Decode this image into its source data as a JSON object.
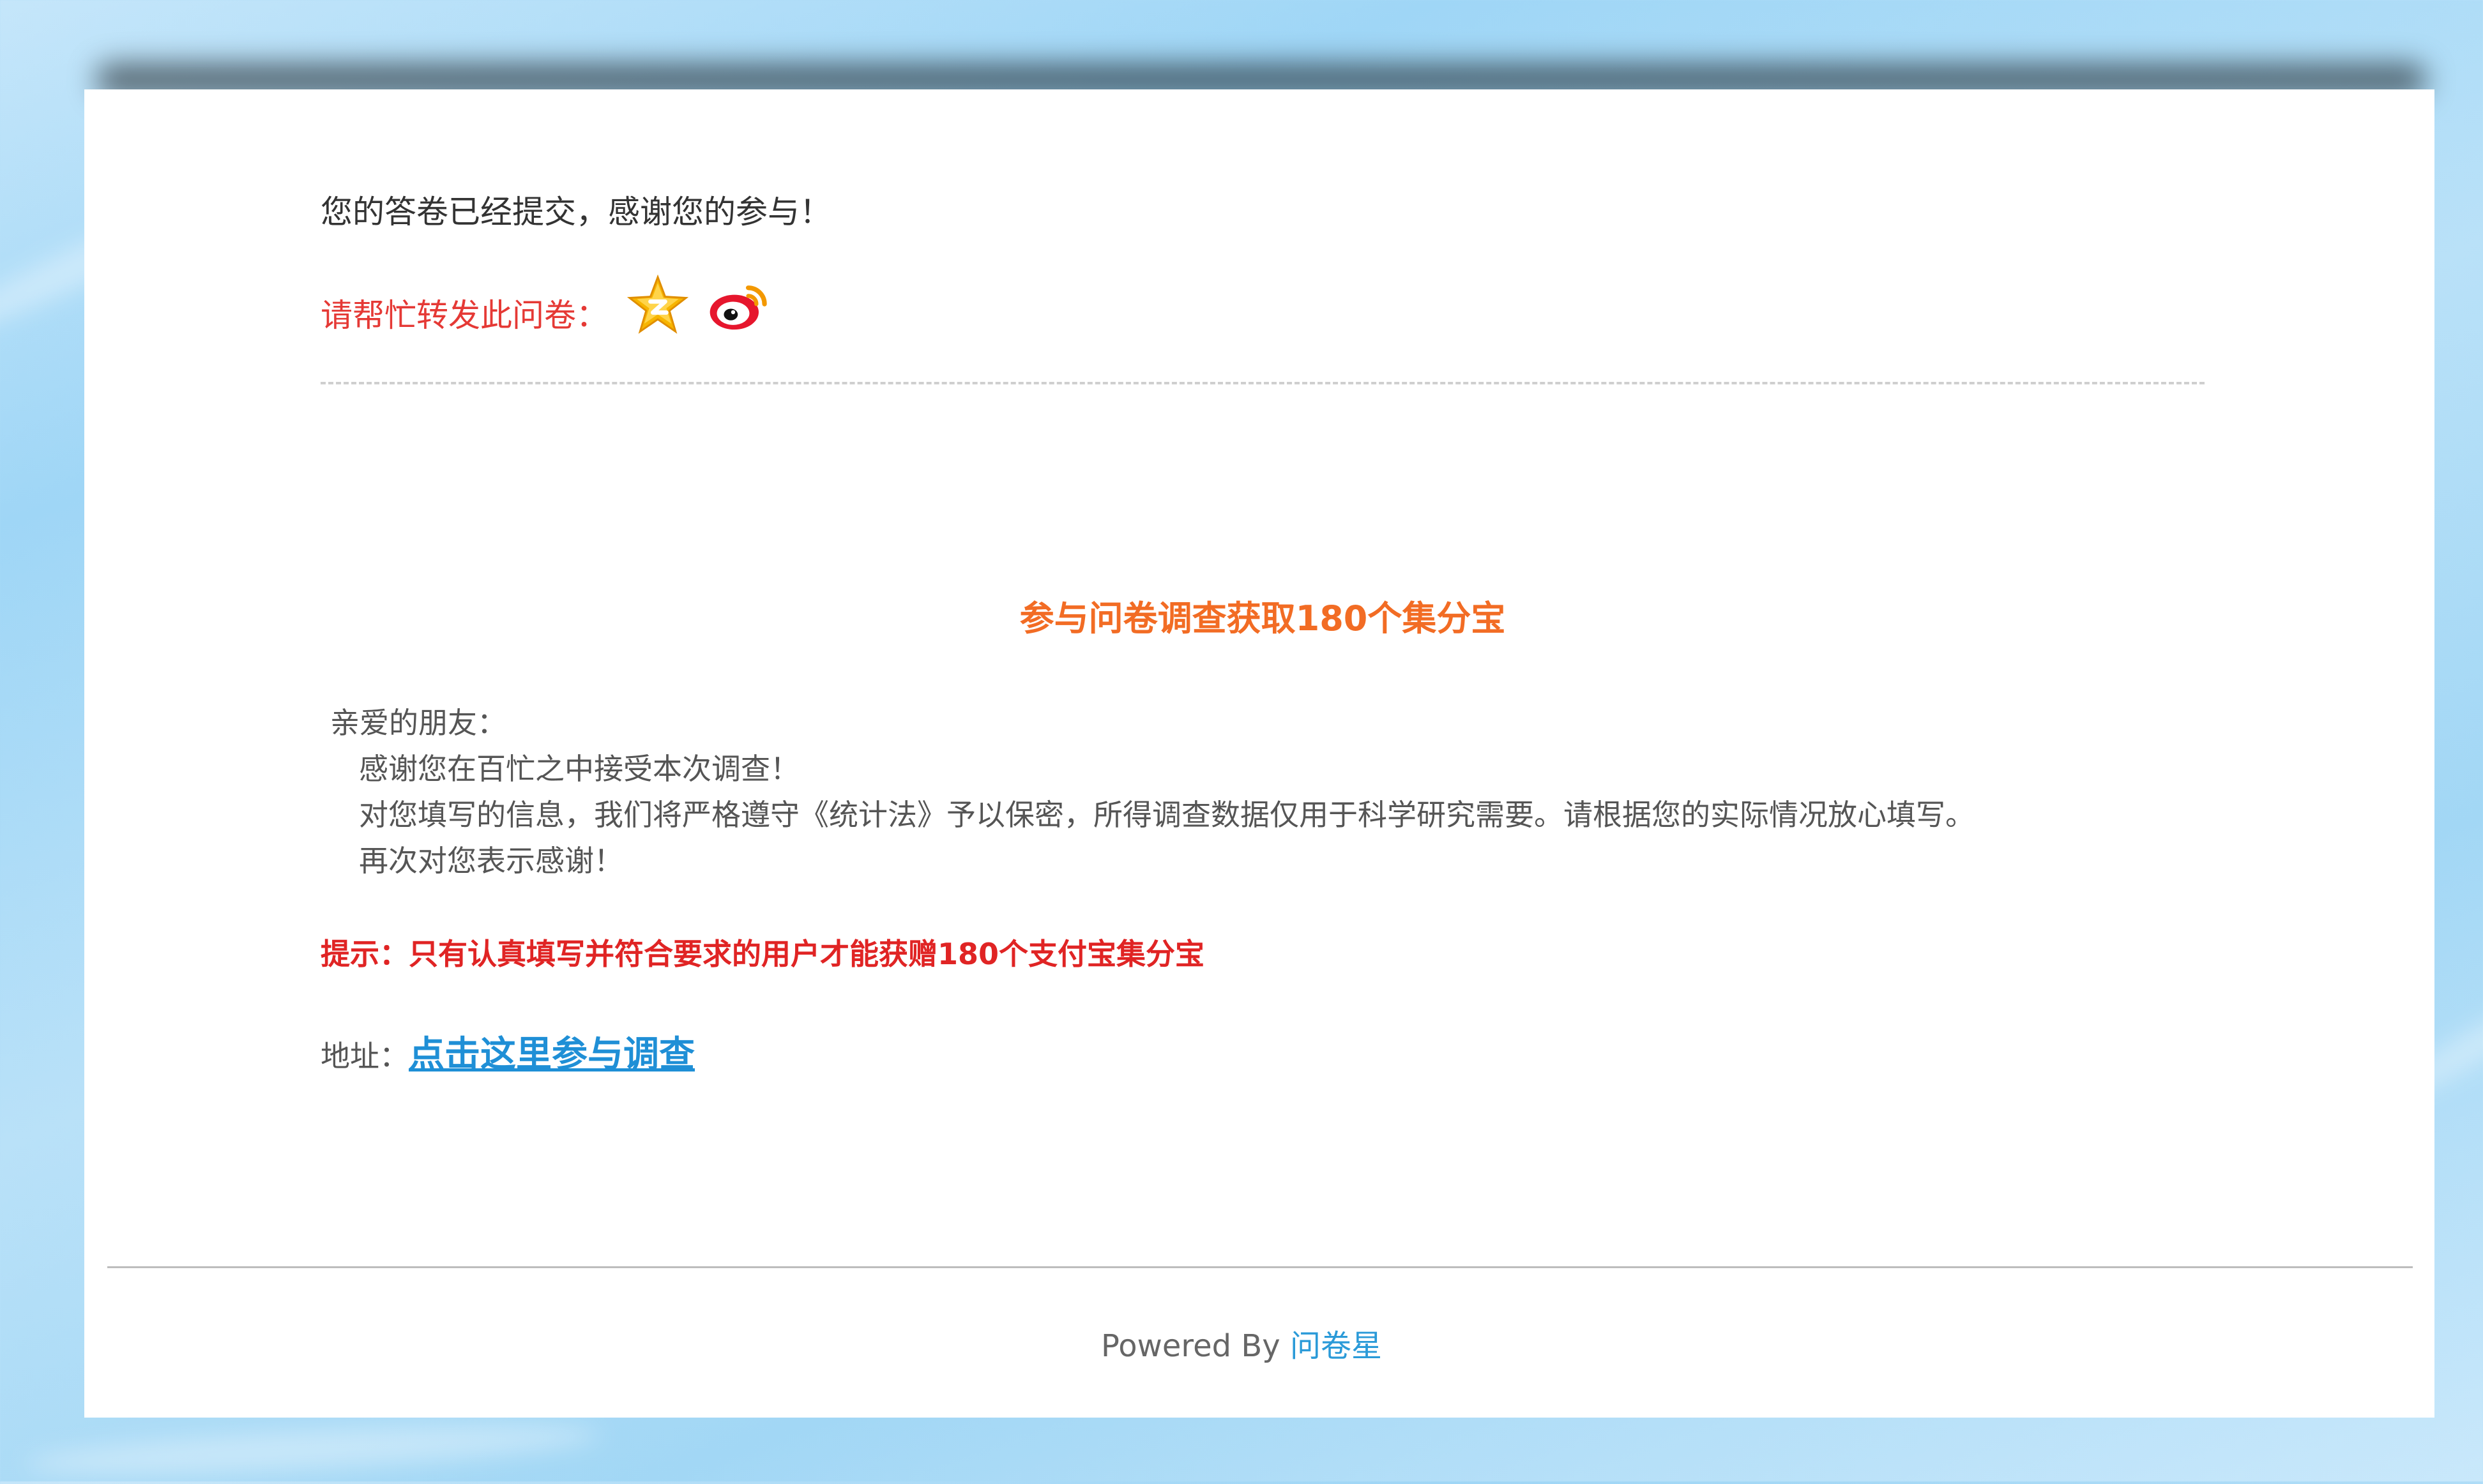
{
  "confirmation": {
    "message": "您的答卷已经提交，感谢您的参与！"
  },
  "share": {
    "label": "请帮忙转发此问卷：",
    "icons": [
      "qzone-star-icon",
      "weibo-icon"
    ]
  },
  "survey": {
    "title": "参与问卷调查获取180个集分宝",
    "greeting": "亲爱的朋友：",
    "paragraphs": [
      "感谢您在百忙之中接受本次调查！",
      "对您填写的信息，我们将严格遵守《统计法》予以保密，所得调查数据仅用于科学研究需要。请根据您的实际情况放心填写。",
      "再次对您表示感谢！"
    ],
    "tip": "提示：只有认真填写并符合要求的用户才能获赠180个支付宝集分宝",
    "address_label": "地址：",
    "address_link": "点击这里参与调查"
  },
  "footer": {
    "powered_by": "Powered By ",
    "brand": "问卷星"
  },
  "colors": {
    "share_label": "#e53935",
    "survey_title": "#f26c24",
    "tip": "#e02424",
    "link": "#1f8fd6",
    "brand": "#2a9ad8"
  }
}
